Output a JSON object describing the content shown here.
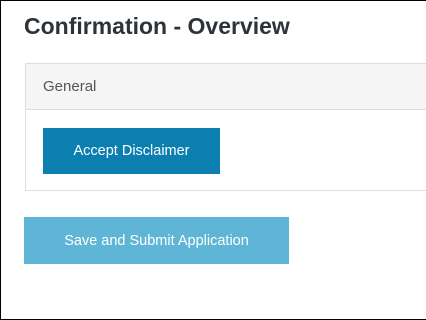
{
  "page": {
    "title": "Confirmation - Overview"
  },
  "panel": {
    "heading": "General",
    "accept_button_label": "Accept Disclaimer"
  },
  "actions": {
    "submit_button_label": "Save and Submit Application"
  },
  "colors": {
    "accept_button_bg": "#0b7fb0",
    "submit_button_bg": "#5fb5d6",
    "panel_heading_bg": "#f5f5f5"
  }
}
